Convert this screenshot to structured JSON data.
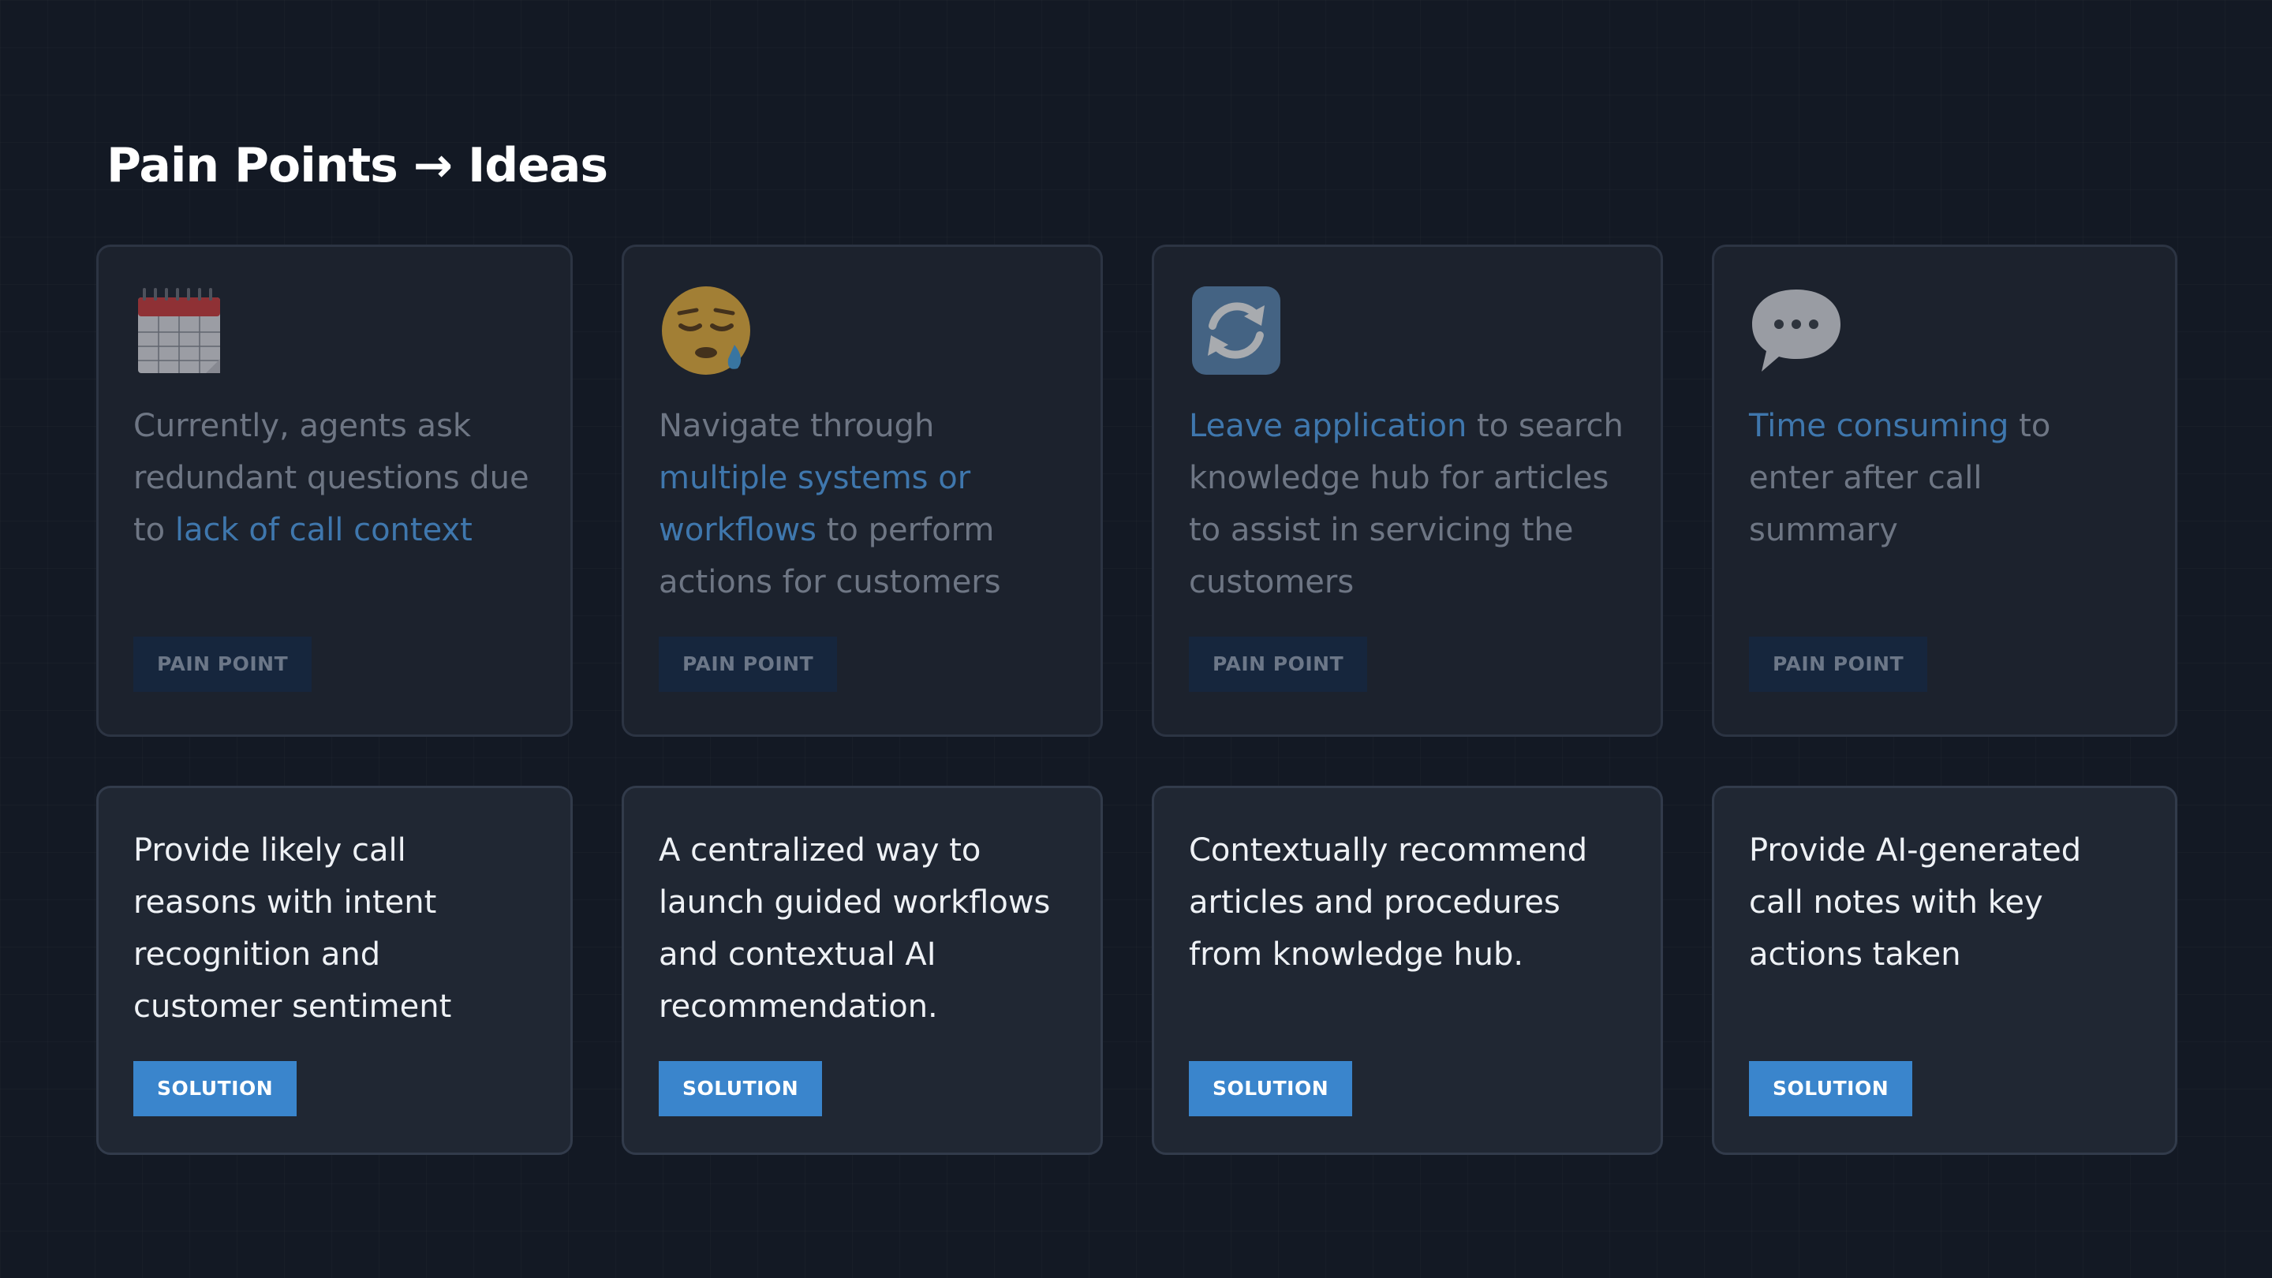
{
  "title": "Pain Points → Ideas",
  "pain_points": [
    {
      "icon": "calendar-icon",
      "segments": [
        {
          "text": "Currently, agents ask redundant questions due to ",
          "highlight": false
        },
        {
          "text": "lack of call context",
          "highlight": true
        }
      ],
      "badge": "PAIN POINT"
    },
    {
      "icon": "sleepy-face-icon",
      "segments": [
        {
          "text": "Navigate through ",
          "highlight": false
        },
        {
          "text": "multiple systems or workflows",
          "highlight": true
        },
        {
          "text": "  to perform actions for customers",
          "highlight": false
        }
      ],
      "badge": "PAIN POINT"
    },
    {
      "icon": "sync-arrows-icon",
      "segments": [
        {
          "text": "Leave application",
          "highlight": true
        },
        {
          "text": " to search knowledge hub for articles to assist in servicing the customers",
          "highlight": false
        }
      ],
      "badge": "PAIN POINT"
    },
    {
      "icon": "speech-bubble-icon",
      "segments": [
        {
          "text": "Time consuming",
          "highlight": true
        },
        {
          "text": "  to enter after call summary",
          "highlight": false
        }
      ],
      "badge": "PAIN POINT"
    }
  ],
  "solutions": [
    {
      "text": "Provide likely call reasons with intent recognition and customer sentiment",
      "badge": "SOLUTION"
    },
    {
      "text": "A centralized way to launch guided workflows and contextual AI recommendation.",
      "badge": "SOLUTION"
    },
    {
      "text": "Contextually recommend articles and procedures from knowledge hub.",
      "badge": "SOLUTION"
    },
    {
      "text": "Provide AI-generated call notes with key actions taken",
      "badge": "SOLUTION"
    }
  ],
  "colors": {
    "background": "#131924",
    "card": "#1c222d",
    "highlight": "#3f77ad",
    "pain_badge_bg": "#16263d",
    "solution_badge_bg": "#3a85cc"
  }
}
